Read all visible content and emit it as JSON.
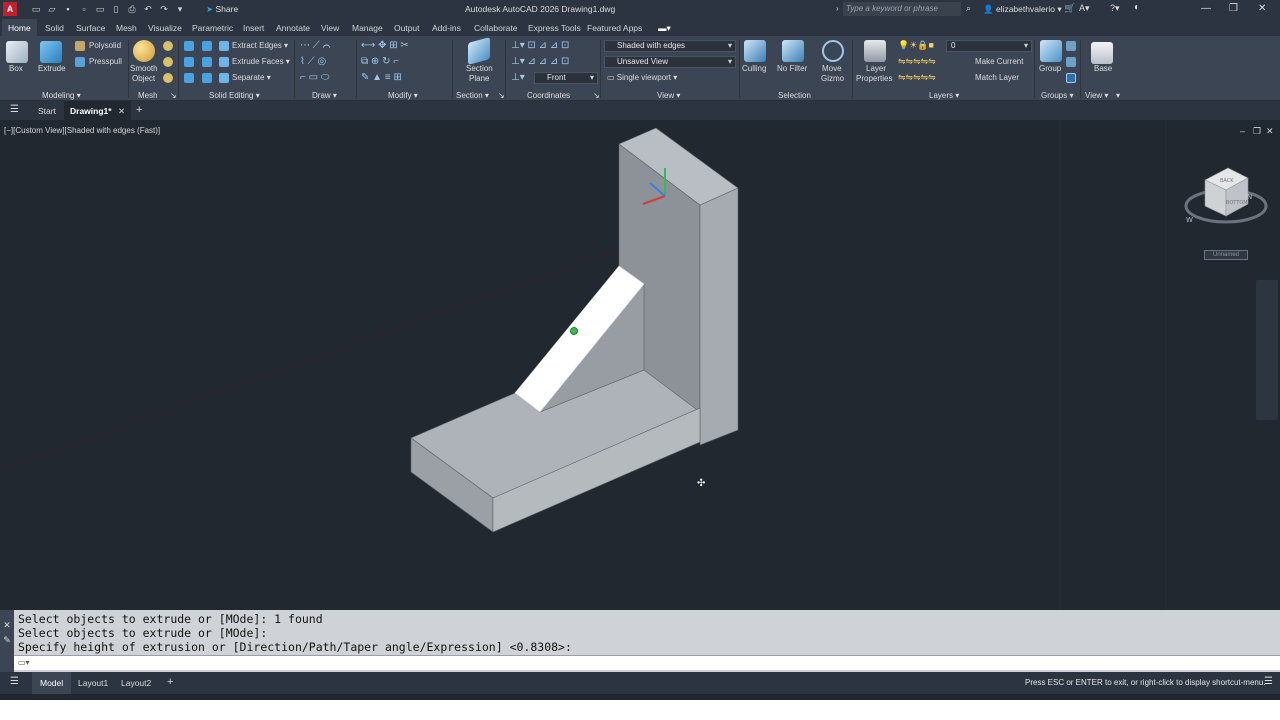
{
  "titlebar": {
    "logo": "A",
    "share_label": "Share",
    "title": "Autodesk AutoCAD 2026   Drawing1.dwg",
    "search_placeholder": "Type a keyword or phrase",
    "user": "elizabethvalerio"
  },
  "ribbon_tabs": [
    "Home",
    "Solid",
    "Surface",
    "Mesh",
    "Visualize",
    "Parametric",
    "Insert",
    "Annotate",
    "View",
    "Manage",
    "Output",
    "Add-ins",
    "Collaborate",
    "Express Tools",
    "Featured Apps"
  ],
  "ribbon": {
    "box": "Box",
    "extrude": "Extrude",
    "polysolid": "Polysolid",
    "presspull": "Presspull",
    "smooth_object_1": "Smooth",
    "smooth_object_2": "Object",
    "extract_edges": "Extract Edges",
    "extrude_faces": "Extrude Faces",
    "separate": "Separate",
    "section_plane_1": "Section",
    "section_plane_2": "Plane",
    "visual_style": "Shaded with edges",
    "saved_view": "Unsaved View",
    "view_direction": "Front",
    "viewport_config": "Single viewport",
    "culling": "Culling",
    "no_filter": "No Filter",
    "move_gizmo_1": "Move",
    "move_gizmo_2": "Gizmo",
    "layer_properties_1": "Layer",
    "layer_properties_2": "Properties",
    "current_layer": "0",
    "make_current": "Make Current",
    "match_layer": "Match Layer",
    "group": "Group",
    "base": "Base",
    "groups": {
      "modeling": "Modeling",
      "mesh": "Mesh",
      "solid_editing": "Solid Editing",
      "draw": "Draw",
      "modify": "Modify",
      "section": "Section",
      "coordinates": "Coordinates",
      "view": "View",
      "selection": "Selection",
      "layers": "Layers",
      "groups": "Groups",
      "view2": "View"
    }
  },
  "doc_tabs": {
    "start": "Start",
    "drawing": "Drawing1*"
  },
  "viewport": {
    "label": "[−][Custom View][Shaded with edges (Fast)]",
    "viewcube_top": "BACK",
    "viewcube_face": "BOTTOM",
    "compass_n": "N",
    "compass_w": "W",
    "unnamed": "Unnamed"
  },
  "command": {
    "lines": [
      "Select objects to extrude or [MOde]: 1 found",
      "Select objects to extrude or [MOde]:",
      "Specify height of extrusion or [Direction/Path/Taper angle/Expression] <0.8308>:"
    ]
  },
  "status": {
    "tabs": [
      "Model",
      "Layout1",
      "Layout2"
    ],
    "message": "Press ESC or ENTER to exit, or right-click to display shortcut-menu."
  },
  "colors": {
    "accent": "#0696d7",
    "background": "#212830"
  }
}
